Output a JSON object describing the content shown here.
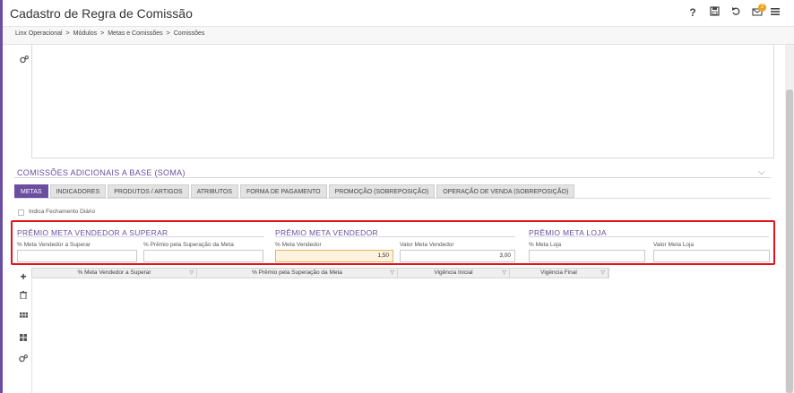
{
  "header": {
    "title": "Cadastro de Regra de Comissão",
    "help_icon": "question-icon",
    "save_icon": "save-icon",
    "undo_icon": "undo-icon",
    "mail_icon": "mail-icon",
    "notification_count": "2",
    "menu_icon": "hamburger-icon"
  },
  "breadcrumb": {
    "items": [
      "Linx Operacional",
      "Módulos",
      "Metas e Comissões",
      "Comissões"
    ],
    "separator": ">"
  },
  "section": {
    "title": "COMISSÕES ADICIONAIS A BASE (SOMA)"
  },
  "tabs": [
    {
      "label": "METAS",
      "active": true
    },
    {
      "label": "INDICADORES"
    },
    {
      "label": "PRODUTOS / ARTIGOS"
    },
    {
      "label": "ATRIBUTOS"
    },
    {
      "label": "FORMA DE PAGAMENTO"
    },
    {
      "label": "PROMOÇÃO (SOBREPOSIÇÃO)"
    },
    {
      "label": "OPERAÇÃO DE VENDA (SOBREPOSIÇÃO)"
    }
  ],
  "checkbox": {
    "label": "Indica Fechamento Diário",
    "checked": false
  },
  "groups": {
    "superar": {
      "title": "PRÊMIO META VENDEDOR A SUPERAR",
      "field1_label": "% Meta Vendedor a Superar",
      "field1_value": "",
      "field2_label": "% Prêmio pela Superação da Meta",
      "field2_value": ""
    },
    "vendedor": {
      "title": "PRÊMIO META VENDEDOR",
      "field1_label": "% Meta Vendedor",
      "field1_value": "1,50",
      "field2_label": "Valor Meta Vendedor",
      "field2_value": "3,00"
    },
    "loja": {
      "title": "PRÊMIO META LOJA",
      "field1_label": "% Meta Loja",
      "field1_value": "",
      "field2_label": "Valor Meta Loja",
      "field2_value": ""
    }
  },
  "grid": {
    "columns": [
      "% Meta Vendedor a Superar",
      "% Prêmio pela Superação da Meta",
      "Vigência Inicial",
      "Vigência Final"
    ]
  },
  "colors": {
    "accent": "#6a4fa0",
    "highlight_border": "#e0141e",
    "focused_field": "#fdf3df"
  }
}
